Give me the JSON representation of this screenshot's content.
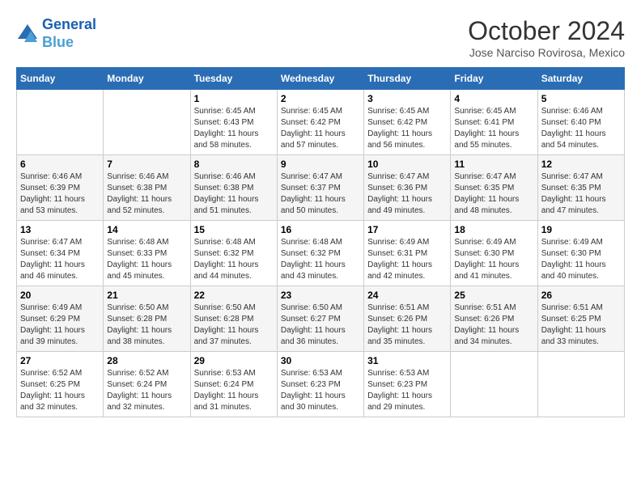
{
  "header": {
    "logo_line1": "General",
    "logo_line2": "Blue",
    "month_title": "October 2024",
    "location": "Jose Narciso Rovirosa, Mexico"
  },
  "days_of_week": [
    "Sunday",
    "Monday",
    "Tuesday",
    "Wednesday",
    "Thursday",
    "Friday",
    "Saturday"
  ],
  "weeks": [
    [
      {
        "day": "",
        "info": ""
      },
      {
        "day": "",
        "info": ""
      },
      {
        "day": "1",
        "info": "Sunrise: 6:45 AM\nSunset: 6:43 PM\nDaylight: 11 hours and 58 minutes."
      },
      {
        "day": "2",
        "info": "Sunrise: 6:45 AM\nSunset: 6:42 PM\nDaylight: 11 hours and 57 minutes."
      },
      {
        "day": "3",
        "info": "Sunrise: 6:45 AM\nSunset: 6:42 PM\nDaylight: 11 hours and 56 minutes."
      },
      {
        "day": "4",
        "info": "Sunrise: 6:45 AM\nSunset: 6:41 PM\nDaylight: 11 hours and 55 minutes."
      },
      {
        "day": "5",
        "info": "Sunrise: 6:46 AM\nSunset: 6:40 PM\nDaylight: 11 hours and 54 minutes."
      }
    ],
    [
      {
        "day": "6",
        "info": "Sunrise: 6:46 AM\nSunset: 6:39 PM\nDaylight: 11 hours and 53 minutes."
      },
      {
        "day": "7",
        "info": "Sunrise: 6:46 AM\nSunset: 6:38 PM\nDaylight: 11 hours and 52 minutes."
      },
      {
        "day": "8",
        "info": "Sunrise: 6:46 AM\nSunset: 6:38 PM\nDaylight: 11 hours and 51 minutes."
      },
      {
        "day": "9",
        "info": "Sunrise: 6:47 AM\nSunset: 6:37 PM\nDaylight: 11 hours and 50 minutes."
      },
      {
        "day": "10",
        "info": "Sunrise: 6:47 AM\nSunset: 6:36 PM\nDaylight: 11 hours and 49 minutes."
      },
      {
        "day": "11",
        "info": "Sunrise: 6:47 AM\nSunset: 6:35 PM\nDaylight: 11 hours and 48 minutes."
      },
      {
        "day": "12",
        "info": "Sunrise: 6:47 AM\nSunset: 6:35 PM\nDaylight: 11 hours and 47 minutes."
      }
    ],
    [
      {
        "day": "13",
        "info": "Sunrise: 6:47 AM\nSunset: 6:34 PM\nDaylight: 11 hours and 46 minutes."
      },
      {
        "day": "14",
        "info": "Sunrise: 6:48 AM\nSunset: 6:33 PM\nDaylight: 11 hours and 45 minutes."
      },
      {
        "day": "15",
        "info": "Sunrise: 6:48 AM\nSunset: 6:32 PM\nDaylight: 11 hours and 44 minutes."
      },
      {
        "day": "16",
        "info": "Sunrise: 6:48 AM\nSunset: 6:32 PM\nDaylight: 11 hours and 43 minutes."
      },
      {
        "day": "17",
        "info": "Sunrise: 6:49 AM\nSunset: 6:31 PM\nDaylight: 11 hours and 42 minutes."
      },
      {
        "day": "18",
        "info": "Sunrise: 6:49 AM\nSunset: 6:30 PM\nDaylight: 11 hours and 41 minutes."
      },
      {
        "day": "19",
        "info": "Sunrise: 6:49 AM\nSunset: 6:30 PM\nDaylight: 11 hours and 40 minutes."
      }
    ],
    [
      {
        "day": "20",
        "info": "Sunrise: 6:49 AM\nSunset: 6:29 PM\nDaylight: 11 hours and 39 minutes."
      },
      {
        "day": "21",
        "info": "Sunrise: 6:50 AM\nSunset: 6:28 PM\nDaylight: 11 hours and 38 minutes."
      },
      {
        "day": "22",
        "info": "Sunrise: 6:50 AM\nSunset: 6:28 PM\nDaylight: 11 hours and 37 minutes."
      },
      {
        "day": "23",
        "info": "Sunrise: 6:50 AM\nSunset: 6:27 PM\nDaylight: 11 hours and 36 minutes."
      },
      {
        "day": "24",
        "info": "Sunrise: 6:51 AM\nSunset: 6:26 PM\nDaylight: 11 hours and 35 minutes."
      },
      {
        "day": "25",
        "info": "Sunrise: 6:51 AM\nSunset: 6:26 PM\nDaylight: 11 hours and 34 minutes."
      },
      {
        "day": "26",
        "info": "Sunrise: 6:51 AM\nSunset: 6:25 PM\nDaylight: 11 hours and 33 minutes."
      }
    ],
    [
      {
        "day": "27",
        "info": "Sunrise: 6:52 AM\nSunset: 6:25 PM\nDaylight: 11 hours and 32 minutes."
      },
      {
        "day": "28",
        "info": "Sunrise: 6:52 AM\nSunset: 6:24 PM\nDaylight: 11 hours and 32 minutes."
      },
      {
        "day": "29",
        "info": "Sunrise: 6:53 AM\nSunset: 6:24 PM\nDaylight: 11 hours and 31 minutes."
      },
      {
        "day": "30",
        "info": "Sunrise: 6:53 AM\nSunset: 6:23 PM\nDaylight: 11 hours and 30 minutes."
      },
      {
        "day": "31",
        "info": "Sunrise: 6:53 AM\nSunset: 6:23 PM\nDaylight: 11 hours and 29 minutes."
      },
      {
        "day": "",
        "info": ""
      },
      {
        "day": "",
        "info": ""
      }
    ]
  ]
}
